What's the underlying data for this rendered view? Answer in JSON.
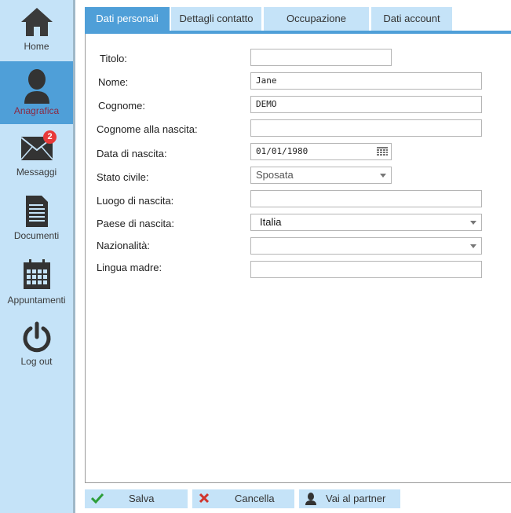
{
  "sidebar": {
    "items": [
      {
        "label": "Home",
        "icon": "home-icon"
      },
      {
        "label": "Anagrafica",
        "icon": "person-icon",
        "active": true
      },
      {
        "label": "Messaggi",
        "icon": "envelope-icon",
        "badge": "2"
      },
      {
        "label": "Documenti",
        "icon": "document-icon"
      },
      {
        "label": "Appuntamenti",
        "icon": "calendar-icon"
      },
      {
        "label": "Log out",
        "icon": "power-icon"
      }
    ]
  },
  "tabs": [
    {
      "label": "Dati personali",
      "active": true
    },
    {
      "label": "Dettagli contatto"
    },
    {
      "label": "Occupazione"
    },
    {
      "label": "Dati account"
    }
  ],
  "form": {
    "titolo": {
      "label": "Titolo:",
      "value": ""
    },
    "nome": {
      "label": "Nome:",
      "value": "Jane"
    },
    "cognome": {
      "label": "Cognome:",
      "value": "DEMO"
    },
    "cognome_nascita": {
      "label": "Cognome alla nascita:",
      "value": ""
    },
    "data_nascita": {
      "label": "Data di nascita:",
      "value": "01/01/1980"
    },
    "stato_civile": {
      "label": "Stato civile:",
      "value": "Sposata"
    },
    "luogo_nascita": {
      "label": "Luogo di nascita:",
      "value": ""
    },
    "paese_nascita": {
      "label": "Paese di nascita:",
      "value": "Italia"
    },
    "nazionalita": {
      "label": "Nazionalità:",
      "value": ""
    },
    "lingua_madre": {
      "label": "Lingua madre:",
      "value": ""
    }
  },
  "buttons": {
    "save": "Salva",
    "cancel": "Cancella",
    "partner": "Vai al partner"
  },
  "colors": {
    "accent": "#4f9fd8",
    "sidebar_bg": "#c5e3f8",
    "active_label": "#8b2942",
    "badge": "#e83a3a",
    "save_check": "#2e9e3a",
    "cancel_x": "#d0342c"
  }
}
